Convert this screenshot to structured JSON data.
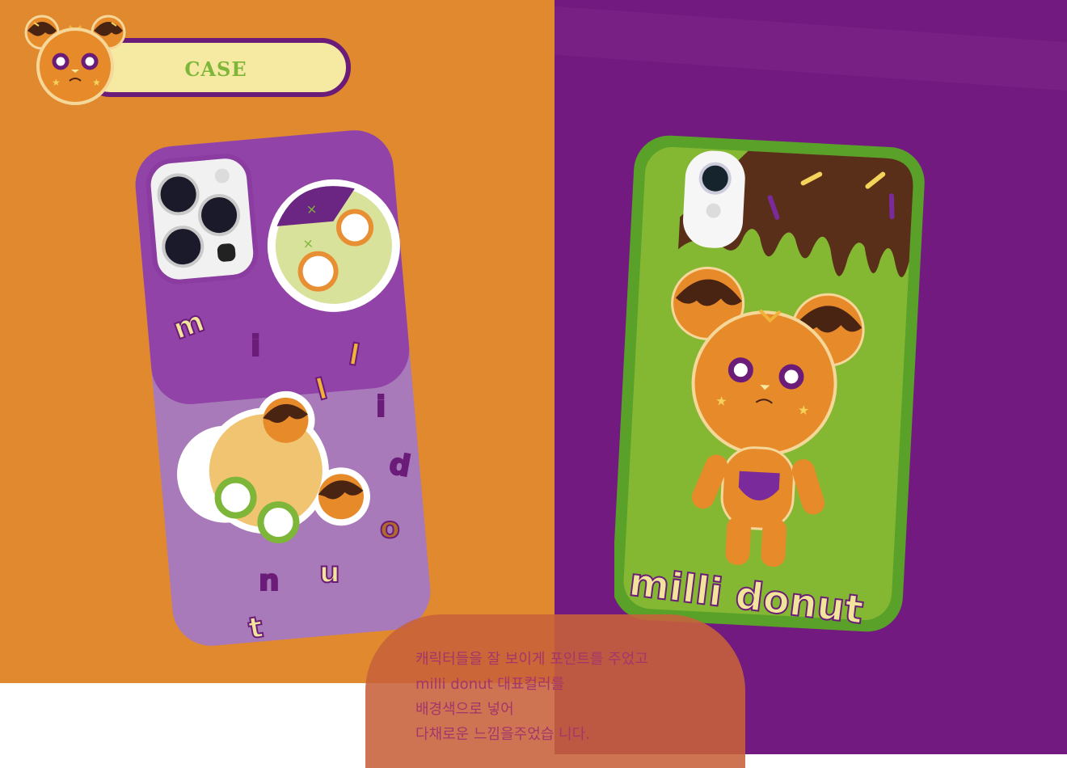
{
  "header": {
    "title": "CASE"
  },
  "phone1": {
    "letters": [
      "m",
      "i",
      "l",
      "l",
      "i",
      "d",
      "o",
      "n",
      "u",
      "t"
    ]
  },
  "phone2": {
    "brand": "milli donut"
  },
  "caption": {
    "lines": [
      "캐릭터들을 잘 보이게 포인트를 주었고",
      "milli donut 대표컬러를",
      "배경색으로 넣어",
      "다채로운 느낌을주었습 니다."
    ]
  },
  "colors": {
    "orange_bg": "#e0892e",
    "purple_bg": "#731a80",
    "case_purple": "#a46fb5",
    "case_green": "#84b833",
    "chocolate": "#5a2f1a",
    "badge_yellow": "#f6e9a2",
    "badge_text": "#7eb63a"
  }
}
